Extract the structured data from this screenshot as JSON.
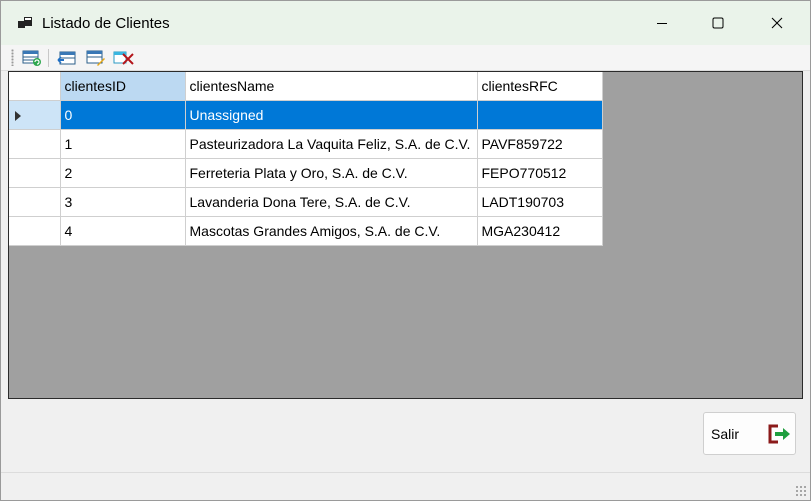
{
  "window": {
    "title": "Listado de Clientes"
  },
  "toolbar": {
    "buttons": [
      "refresh-icon",
      "move-left-icon",
      "edit-icon",
      "delete-icon"
    ]
  },
  "grid": {
    "columns": [
      "clientesID",
      "clientesName",
      "clientesRFC"
    ],
    "rows": [
      {
        "id": "0",
        "name": "Unassigned",
        "rfc": ""
      },
      {
        "id": "1",
        "name": "Pasteurizadora La Vaquita Feliz, S.A. de C.V.",
        "rfc": "PAVF859722"
      },
      {
        "id": "2",
        "name": "Ferreteria Plata y Oro,  S.A. de C.V.",
        "rfc": "FEPO770512"
      },
      {
        "id": "3",
        "name": "Lavanderia Dona Tere, S.A. de C.V.",
        "rfc": "LADT190703"
      },
      {
        "id": "4",
        "name": "Mascotas Grandes Amigos, S.A. de C.V.",
        "rfc": "MGA230412"
      }
    ],
    "selected_row": 0
  },
  "footer": {
    "exit_label": "Salir"
  },
  "colors": {
    "selection": "#0078d7",
    "grid_background": "#a0a0a0",
    "sorted_header": "#bcd9f2"
  }
}
